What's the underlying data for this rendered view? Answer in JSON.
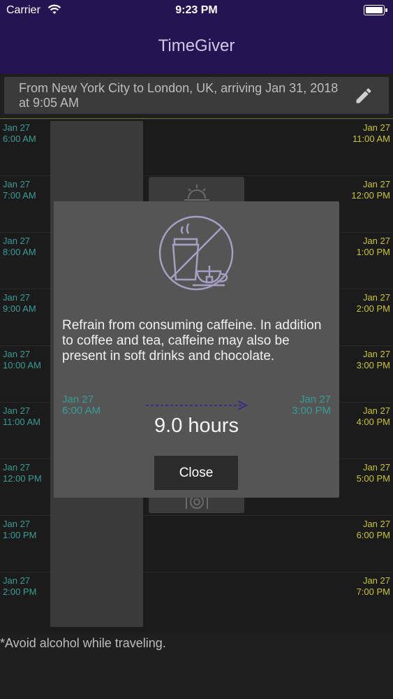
{
  "status": {
    "carrier": "Carrier",
    "time": "9:23 PM"
  },
  "app": {
    "title": "TimeGiver"
  },
  "route": {
    "text": "From New York City to London, UK, arriving Jan 31, 2018 at 9:05 AM"
  },
  "schedule": {
    "rows": [
      {
        "left_date": "Jan 27",
        "left_time": "6:00 AM",
        "right_date": "Jan 27",
        "right_time": "11:00 AM"
      },
      {
        "left_date": "Jan 27",
        "left_time": "7:00 AM",
        "right_date": "Jan 27",
        "right_time": "12:00 PM"
      },
      {
        "left_date": "Jan 27",
        "left_time": "8:00 AM",
        "right_date": "Jan 27",
        "right_time": "1:00 PM"
      },
      {
        "left_date": "Jan 27",
        "left_time": "9:00 AM",
        "right_date": "Jan 27",
        "right_time": "2:00 PM"
      },
      {
        "left_date": "Jan 27",
        "left_time": "10:00 AM",
        "right_date": "Jan 27",
        "right_time": "3:00 PM"
      },
      {
        "left_date": "Jan 27",
        "left_time": "11:00 AM",
        "right_date": "Jan 27",
        "right_time": "4:00 PM"
      },
      {
        "left_date": "Jan 27",
        "left_time": "12:00 PM",
        "right_date": "Jan 27",
        "right_time": "5:00 PM"
      },
      {
        "left_date": "Jan 27",
        "left_time": "1:00 PM",
        "right_date": "Jan 27",
        "right_time": "6:00 PM"
      },
      {
        "left_date": "Jan 27",
        "left_time": "2:00 PM",
        "right_date": "Jan 27",
        "right_time": "7:00 PM"
      }
    ]
  },
  "footnote": "*Avoid alcohol while traveling.",
  "modal": {
    "icon": "no-caffeine-icon",
    "message": "Refrain from consuming caffeine.  In addition to coffee and tea, caffeine may also be present in soft drinks and chocolate.",
    "start_date": "Jan 27",
    "start_time": "6:00 AM",
    "end_date": "Jan 27",
    "end_time": "3:00 PM",
    "duration": "9.0 hours",
    "close_label": "Close"
  },
  "colors": {
    "nav": "#261452",
    "origin_time": "#3a9c95",
    "destination_time": "#c9c338",
    "arrow": "#3d2a8a"
  }
}
